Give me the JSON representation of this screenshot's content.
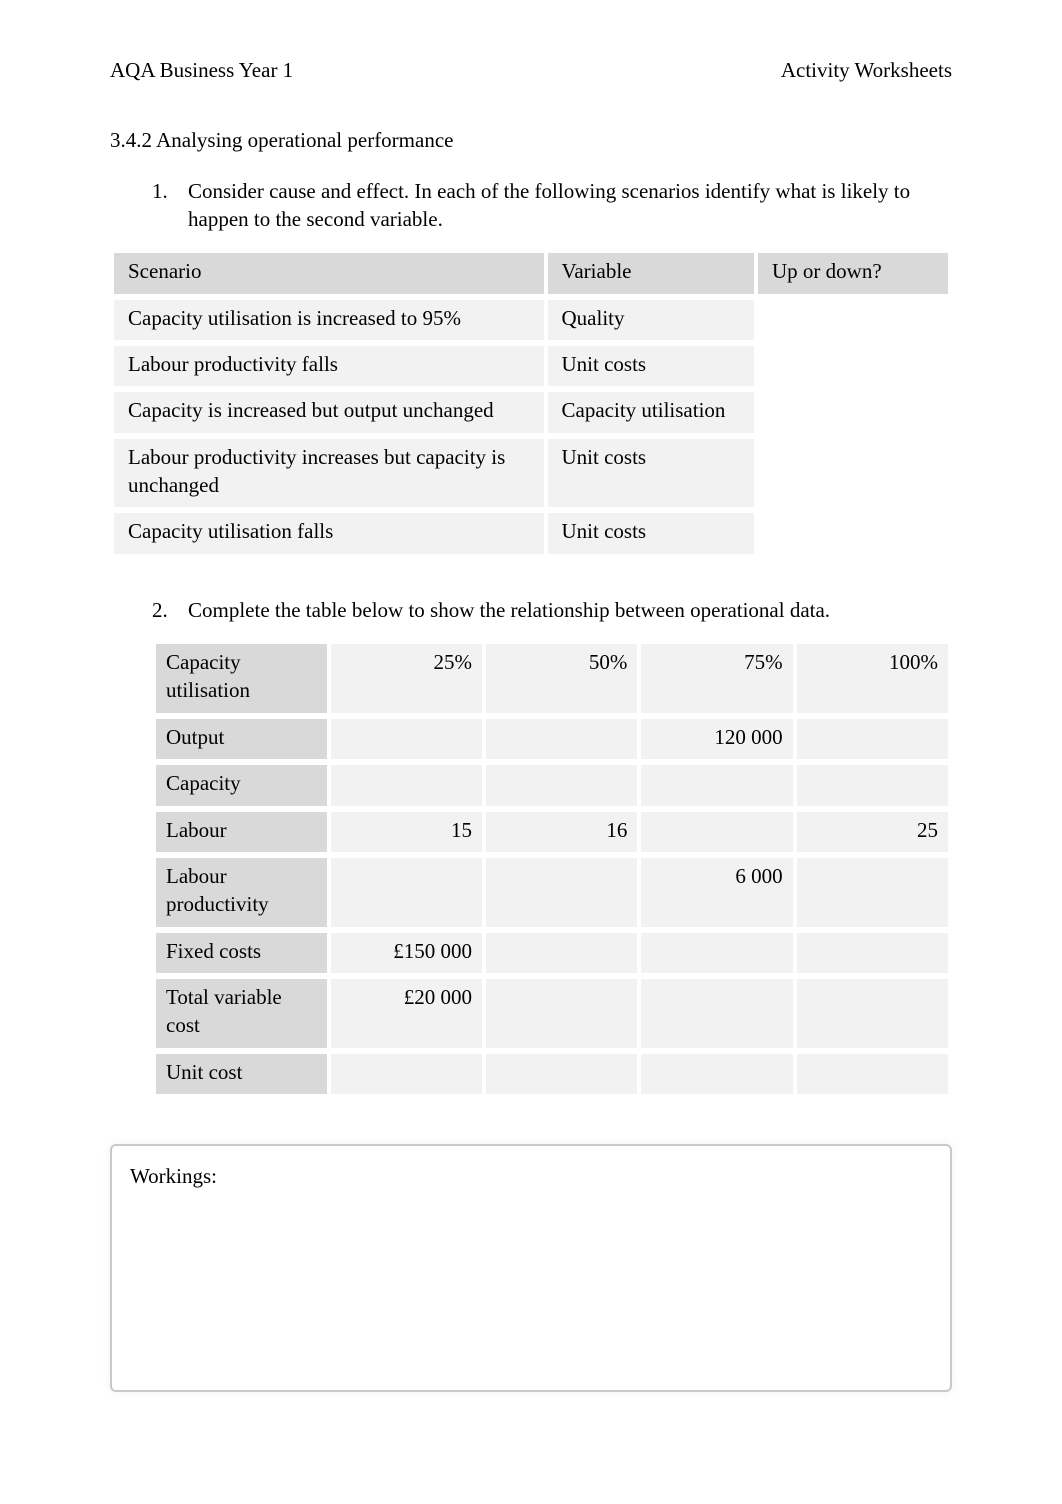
{
  "header": {
    "left": "AQA Business Year 1",
    "right": "Activity Worksheets"
  },
  "section_title": "3.4.2 Analysing operational performance",
  "q1": {
    "number": "1.",
    "text": "Consider cause and effect. In each of the following scenarios identify what is likely to happen to the second variable.",
    "headers": [
      "Scenario",
      "Variable",
      "Up or down?"
    ],
    "rows": [
      {
        "scenario": "Capacity utilisation is increased to 95%",
        "variable": "Quality",
        "answer": ""
      },
      {
        "scenario": "Labour productivity falls",
        "variable": "Unit costs",
        "answer": ""
      },
      {
        "scenario": "Capacity is increased but output unchanged",
        "variable": "Capacity utilisation",
        "answer": ""
      },
      {
        "scenario": "Labour productivity increases but capacity is unchanged",
        "variable": "Unit costs",
        "answer": ""
      },
      {
        "scenario": "Capacity utilisation falls",
        "variable": "Unit costs",
        "answer": ""
      }
    ]
  },
  "q2": {
    "number": "2.",
    "text": "Complete the table below to show the relationship between operational data.",
    "row_labels": [
      "Capacity utilisation",
      "Output",
      "Capacity",
      "Labour",
      "Labour productivity",
      "Fixed costs",
      "Total variable cost",
      "Unit cost"
    ],
    "col_headers": [
      "25%",
      "50%",
      "75%",
      "100%"
    ],
    "cells": {
      "output_75": "120 000",
      "labour_25": "15",
      "labour_50": "16",
      "labour_100": "25",
      "lp_75": "6 000",
      "fixed_25": "£150 000",
      "tvc_25": "£20 000"
    }
  },
  "workings_label": "Workings:"
}
